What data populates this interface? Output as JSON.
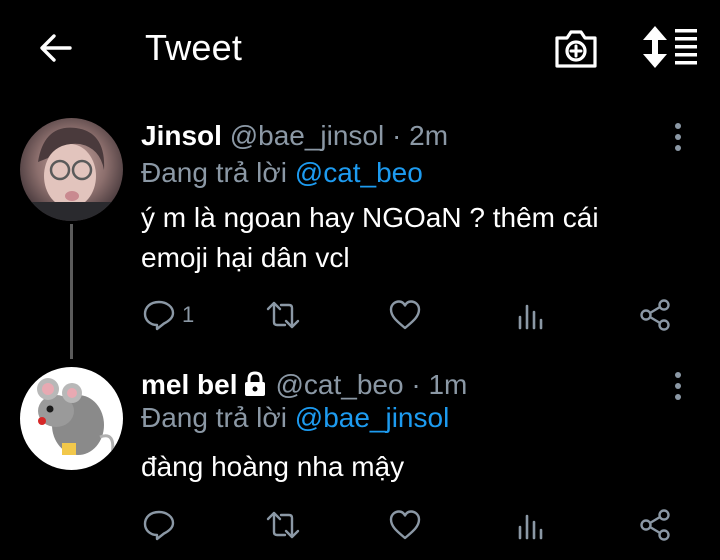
{
  "header": {
    "title": "Tweet"
  },
  "tweets": [
    {
      "name": "Jinsol",
      "handle": "@bae_jinsol",
      "time": "· 2m",
      "reply_prefix": "Đang trả lời",
      "reply_to": "@cat_beo",
      "lines": [
        "ý m là ngoan hay NGOaN ? thêm cái",
        "emoji hại dân vcl"
      ],
      "reply_count": "1"
    },
    {
      "name": "mel bel",
      "handle": "@cat_beo",
      "time": "· 1m",
      "reply_prefix": "Đang trả lời",
      "reply_to": "@bae_jinsol",
      "lines": [
        "đàng hoàng nha mậy"
      ],
      "protected": true
    }
  ],
  "colors": {
    "background": "#000000",
    "text": "#ffffff",
    "secondary": "#8b98a5",
    "accent": "#1d9bf0"
  },
  "icons": [
    "back-arrow-icon",
    "camera-icon",
    "sort-icon",
    "more-vert-icon",
    "reply-icon",
    "retweet-icon",
    "like-icon",
    "analytics-icon",
    "share-icon",
    "lock-icon"
  ]
}
